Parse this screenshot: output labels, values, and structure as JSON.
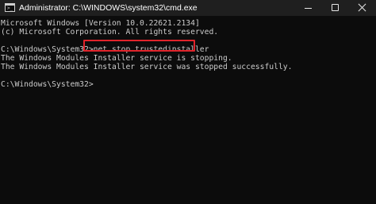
{
  "window": {
    "title": "Administrator: C:\\WINDOWS\\system32\\cmd.exe",
    "app_icon": "cmd-prompt-icon",
    "controls": [
      "minimize-icon",
      "maximize-icon",
      "close-icon"
    ]
  },
  "console": {
    "lines": [
      "Microsoft Windows [Version 10.0.22621.2134]",
      "(c) Microsoft Corporation. All rights reserved.",
      "",
      "C:\\Windows\\System32>net stop trustedinstaller",
      "The Windows Modules Installer service is stopping.",
      "The Windows Modules Installer service was stopped successfully.",
      "",
      "C:\\Windows\\System32>"
    ],
    "highlight_color": "#e0242b",
    "text_color": "#cccccc",
    "background_color": "#0c0c0c"
  }
}
